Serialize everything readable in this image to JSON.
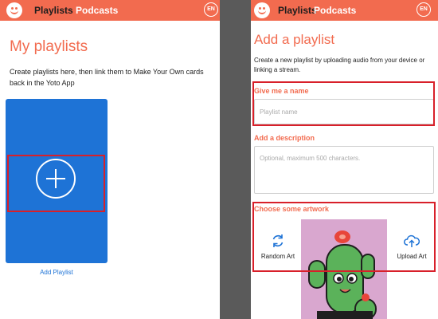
{
  "left": {
    "nav": {
      "playlists": "Playlists",
      "podcasts": "Podcasts",
      "lang": "EN"
    },
    "title": "My playlists",
    "description": "Create playlists here, then link them to Make Your Own cards back in the Yoto App",
    "add_label": "Add Playlist"
  },
  "right": {
    "nav": {
      "playlists": "Playlists",
      "podcasts": "Podcasts",
      "lang": "EN"
    },
    "title": "Add a playlist",
    "description": "Create a new playlist by uploading audio from your device or linking a stream.",
    "name_label": "Give me a name",
    "name_placeholder": "Playlist name",
    "desc_label": "Add a description",
    "desc_placeholder": "Optional, maximum 500 characters.",
    "artwork_label": "Choose some artwork",
    "random_art": "Random Art",
    "upload_art": "Upload Art"
  },
  "colors": {
    "brand": "#f26b4f",
    "card": "#1e73d6",
    "highlight": "#d8202a"
  }
}
